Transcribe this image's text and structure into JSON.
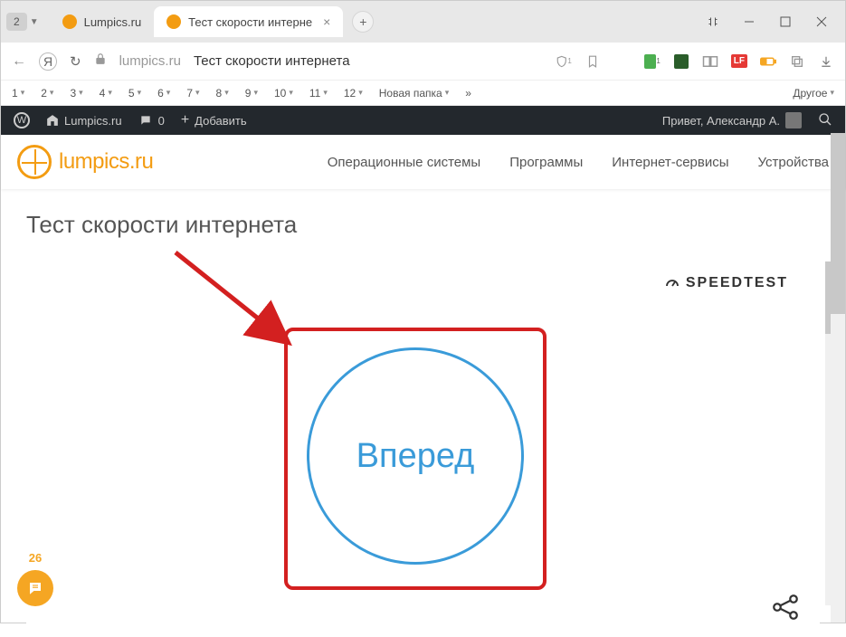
{
  "window": {
    "tab_count": "2",
    "tabs": [
      {
        "title": "Lumpics.ru",
        "active": false
      },
      {
        "title": "Тест скорости интерне",
        "active": true
      }
    ]
  },
  "address": {
    "domain": "lumpics.ru",
    "title": "Тест скорости интернета"
  },
  "bookmarks": {
    "items": [
      "1",
      "2",
      "3",
      "4",
      "5",
      "6",
      "7",
      "8",
      "9",
      "10",
      "11",
      "12"
    ],
    "folder": "Новая папка",
    "more": "»",
    "other": "Другое"
  },
  "wpbar": {
    "site": "Lumpics.ru",
    "comments": "0",
    "add": "Добавить",
    "greeting": "Привет, Александр А."
  },
  "site": {
    "logo_text": "lumpics.ru",
    "nav": [
      "Операционные системы",
      "Программы",
      "Интернет-сервисы",
      "Устройства"
    ]
  },
  "page": {
    "title": "Тест скорости интернета",
    "speedtest_label": "SPEEDTEST",
    "go_label": "Вперед",
    "chat_count": "26"
  }
}
